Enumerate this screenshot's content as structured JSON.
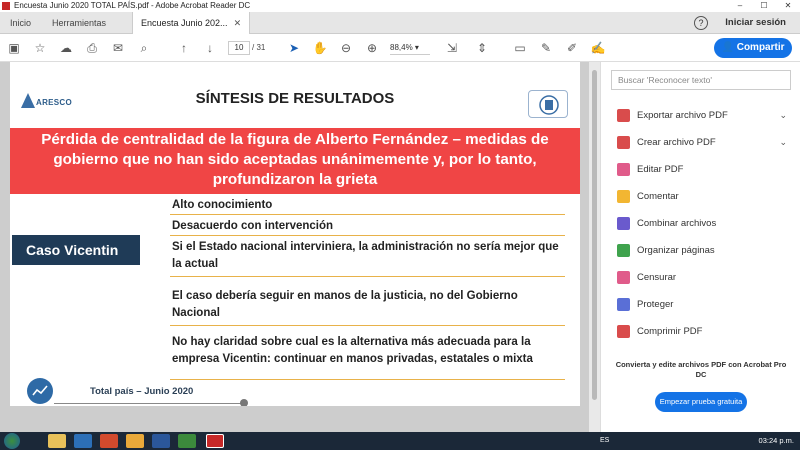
{
  "window": {
    "title": "Encuesta Junio 2020 TOTAL PAÍS.pdf - Adobe Acrobat Reader DC"
  },
  "tabs": {
    "inicio": "Inicio",
    "herramientas": "Herramientas",
    "document": "Encuesta Junio 202..."
  },
  "header": {
    "signin": "Iniciar sesión"
  },
  "toolbar": {
    "page_current": "10",
    "page_total": "/ 31",
    "zoom": "88,4%",
    "share": "Compartir"
  },
  "page": {
    "logo_left": "ARESCO",
    "title": "SÍNTESIS DE RESULTADOS",
    "banner": "Pérdida de centralidad de la figura de Alberto Fernández – medidas de gobierno que no han sido aceptadas unánimemente y, por lo tanto, profundizaron la grieta",
    "case_label": "Caso Vicentin",
    "items": [
      "Alto conocimiento",
      "Desacuerdo con intervención",
      "Si el Estado nacional interviniera, la administración no sería mejor que la actual",
      "El caso debería seguir en manos de la justicia, no del Gobierno Nacional",
      "No hay claridad sobre cual es la alternativa  más adecuada para la empresa Vicentin: continuar en manos privadas, estatales o mixta"
    ],
    "footer": "Total país – Junio 2020"
  },
  "sidebar": {
    "search_placeholder": "Buscar 'Reconocer texto'",
    "tools": [
      {
        "label": "Exportar archivo PDF",
        "color": "#d94c4c",
        "chevron": "⌄"
      },
      {
        "label": "Crear archivo PDF",
        "color": "#d94c4c",
        "chevron": "⌄"
      },
      {
        "label": "Editar PDF",
        "color": "#e05b8a"
      },
      {
        "label": "Comentar",
        "color": "#f2b632"
      },
      {
        "label": "Combinar archivos",
        "color": "#6a5acd"
      },
      {
        "label": "Organizar páginas",
        "color": "#3fa34d"
      },
      {
        "label": "Censurar",
        "color": "#e05b8a"
      },
      {
        "label": "Proteger",
        "color": "#5a6fd6"
      },
      {
        "label": "Comprimir PDF",
        "color": "#d94c4c"
      }
    ],
    "convert_text": "Convierta y edite archivos PDF con Acrobat Pro DC",
    "trial_button": "Empezar prueba gratuita"
  },
  "taskbar": {
    "lang": "ES",
    "time": "03:24 p.m."
  }
}
